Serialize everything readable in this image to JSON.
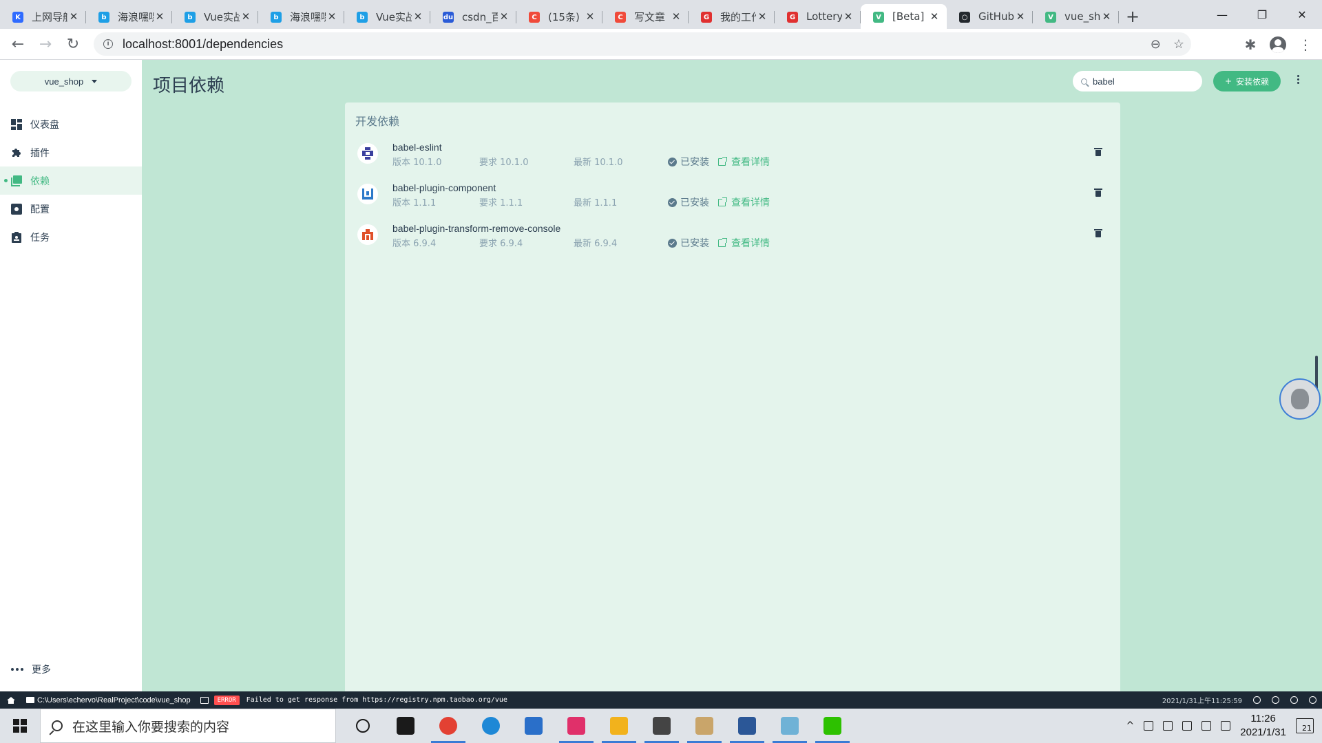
{
  "browser": {
    "tabs": [
      {
        "title": "上网导航",
        "favicon_color": "#2f6bff",
        "favicon_glyph": "K"
      },
      {
        "title": "海浪嘿嘿",
        "favicon_color": "#1e9fe6",
        "favicon_glyph": "b"
      },
      {
        "title": "Vue实战",
        "favicon_color": "#1e9fe6",
        "favicon_glyph": "b"
      },
      {
        "title": "海浪嘿嘿",
        "favicon_color": "#1e9fe6",
        "favicon_glyph": "b"
      },
      {
        "title": "Vue实战",
        "favicon_color": "#1e9fe6",
        "favicon_glyph": "b"
      },
      {
        "title": "csdn_百度",
        "favicon_color": "#2a5bd7",
        "favicon_glyph": "du"
      },
      {
        "title": "(15条)",
        "favicon_color": "#f04a3a",
        "favicon_glyph": "C"
      },
      {
        "title": "写文章",
        "favicon_color": "#f04a3a",
        "favicon_glyph": "C"
      },
      {
        "title": "我的工作台",
        "favicon_color": "#e03030",
        "favicon_glyph": "G"
      },
      {
        "title": "Lottery",
        "favicon_color": "#e03030",
        "favicon_glyph": "G"
      },
      {
        "title": "[Beta]",
        "favicon_color": "#42b983",
        "favicon_glyph": "V",
        "active": true
      },
      {
        "title": "GitHub",
        "favicon_color": "#24292e",
        "favicon_glyph": "○"
      },
      {
        "title": "vue_shop",
        "favicon_color": "#42b983",
        "favicon_glyph": "V"
      }
    ],
    "new_tab": "+",
    "window_controls": {
      "minimize": "—",
      "restore": "❐",
      "close": "✕"
    },
    "tab_close_glyph": "✕",
    "url": "localhost:8001/dependencies",
    "nav": {
      "back": "←",
      "forward": "→",
      "reload": "↻"
    },
    "omni_icons": {
      "zoom": "⊖",
      "bookmark": "☆"
    },
    "toolbar_icons": {
      "extensions": "✱",
      "menu": "⋮"
    }
  },
  "app": {
    "project_name": "vue_shop",
    "page_title": "项目依赖",
    "search_value": "babel",
    "install_button": "安装依赖",
    "install_button_icon": "+",
    "sidebar": {
      "items": [
        {
          "label": "仪表盘",
          "icon": "dashboard-icon"
        },
        {
          "label": "插件",
          "icon": "puzzle-icon"
        },
        {
          "label": "依赖",
          "icon": "library-icon",
          "active": true
        },
        {
          "label": "配置",
          "icon": "settings-icon"
        },
        {
          "label": "任务",
          "icon": "clipboard-icon"
        }
      ],
      "more_label": "更多"
    },
    "section_title": "开发依赖",
    "dependencies": [
      {
        "name": "babel-eslint",
        "version": "版本 10.1.0",
        "required": "要求 10.1.0",
        "latest": "最新 10.1.0",
        "status": "已安装",
        "details": "查看详情",
        "icon_color": "#3a3f9e"
      },
      {
        "name": "babel-plugin-component",
        "version": "版本 1.1.1",
        "required": "要求 1.1.1",
        "latest": "最新 1.1.1",
        "status": "已安装",
        "details": "查看详情",
        "icon_color": "#2c79c9"
      },
      {
        "name": "babel-plugin-transform-remove-console",
        "version": "版本 6.9.4",
        "required": "要求 6.9.4",
        "latest": "最新 6.9.4",
        "status": "已安装",
        "details": "查看详情",
        "icon_color": "#e0512a"
      }
    ]
  },
  "statusbar": {
    "path": "C:\\Users\\echervo\\RealProject\\code\\vue_shop",
    "error_badge": "ERROR",
    "log_message": "Failed to get response from https://registry.npm.taobao.org/vue",
    "timestamp": "2021/1/31上午11:25:59"
  },
  "taskbar": {
    "search_placeholder": "在这里输入你要搜索的内容",
    "apps": [
      {
        "name": "cortana",
        "color": "#1a1a1a"
      },
      {
        "name": "task-view",
        "color": "#1a1a1a"
      },
      {
        "name": "chrome",
        "color": "#e34133",
        "running": true
      },
      {
        "name": "edge",
        "color": "#1e88d6"
      },
      {
        "name": "notepad",
        "color": "#2a6fc9"
      },
      {
        "name": "intellij",
        "color": "#e0306a",
        "running": true
      },
      {
        "name": "file-explorer",
        "color": "#f2b21c",
        "running": true
      },
      {
        "name": "settings",
        "color": "#444444",
        "running": true
      },
      {
        "name": "image-viewer",
        "color": "#c9a56a",
        "running": true
      },
      {
        "name": "powershell",
        "color": "#2b5797",
        "running": true
      },
      {
        "name": "notes",
        "color": "#6fb2d6",
        "running": true
      },
      {
        "name": "wechat",
        "color": "#2dc100",
        "running": true
      }
    ],
    "time": "11:26",
    "date": "2021/1/31",
    "tray_up": "^",
    "notification_count": "21"
  }
}
